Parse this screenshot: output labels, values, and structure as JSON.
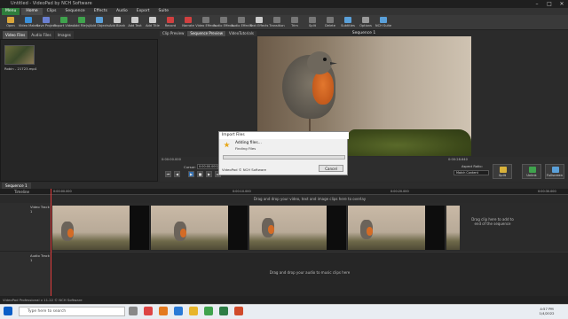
{
  "app": {
    "title": "Untitled - VideoPad by NCH Software"
  },
  "menu": {
    "items": [
      "Menu",
      "Home",
      "Clips",
      "Sequence",
      "Effects",
      "Audio",
      "Export",
      "Suite"
    ]
  },
  "toolbar": {
    "items": [
      {
        "label": "Open",
        "color": "#d9a53a"
      },
      {
        "label": "Video Maker",
        "color": "#3a8fd9"
      },
      {
        "label": "Save Project",
        "color": "#6a7fd0"
      },
      {
        "label": "Export Video",
        "color": "#3fa34d"
      },
      {
        "label": "Add File(s)",
        "color": "#3fa34d"
      },
      {
        "label": "Add Objects",
        "color": "#5aa0d9"
      },
      {
        "label": "Add Blank",
        "color": "#cccccc"
      },
      {
        "label": "Add Text",
        "color": "#cccccc"
      },
      {
        "label": "Add Title",
        "color": "#cccccc"
      },
      {
        "label": "Record",
        "color": "#d04040"
      },
      {
        "label": "Narrate",
        "color": "#d04040"
      },
      {
        "label": "Video Effects",
        "color": "#777777"
      },
      {
        "label": "Audio Effects",
        "color": "#777777"
      },
      {
        "label": "Audio Effects",
        "color": "#777777"
      },
      {
        "label": "Text Effects",
        "color": "#cccccc"
      },
      {
        "label": "Transition",
        "color": "#777777"
      },
      {
        "label": "Trim",
        "color": "#777777"
      },
      {
        "label": "Split",
        "color": "#777777"
      },
      {
        "label": "Delete",
        "color": "#777777"
      },
      {
        "label": "Subtitles",
        "color": "#5aa0d9"
      },
      {
        "label": "Options",
        "color": "#9a9a9a"
      },
      {
        "label": "NCH Suite",
        "color": "#5aa0d9"
      }
    ]
  },
  "bins": {
    "tabs": [
      "Video Files",
      "Audio Files",
      "Images"
    ],
    "clip_name": "Robin - 21723.mp4"
  },
  "preview": {
    "tabs": [
      "Clip Preview",
      "Sequence Preview",
      "VideoTutorials"
    ],
    "title": "Sequence 1",
    "timecode_left": "0:00:00.000",
    "timecode_right": "0:00:28.640",
    "cursor_label": "Cursor:",
    "cursor_value": "0:00:00.000",
    "aspect_label": "Aspect Ratio:",
    "aspect_value": "Match Content",
    "btn_split": "Split",
    "btn_unlink": "Unlink",
    "btn_fullscreen": "Fullscreen"
  },
  "dialog": {
    "title": "Import Files",
    "message": "Adding files...",
    "sub": "Finding Files",
    "brand": "VideoPad © NCH Software",
    "cancel": "Cancel"
  },
  "timeline": {
    "seq_tab": "Sequence 1",
    "ruler_label": "Timeline",
    "ticks": [
      "0:00:00.000",
      "0:00:10.000",
      "0:00:20.000",
      "0:00:30.000"
    ],
    "video_drop": "Drag and drop your video, text and image clips here to overlay",
    "video_track": "Video Track 1",
    "audio_track": "Audio Track 1",
    "tail_drop": "Drag clip here to add to end of the sequence",
    "audio_drop": "Drag and drop your audio to music clips here"
  },
  "status": {
    "text": "VideoPad Professional v 11.22 © NCH Software"
  },
  "taskbar": {
    "search_placeholder": "Type here to search",
    "time": "4:57 PM",
    "date": "1/4/2022"
  }
}
